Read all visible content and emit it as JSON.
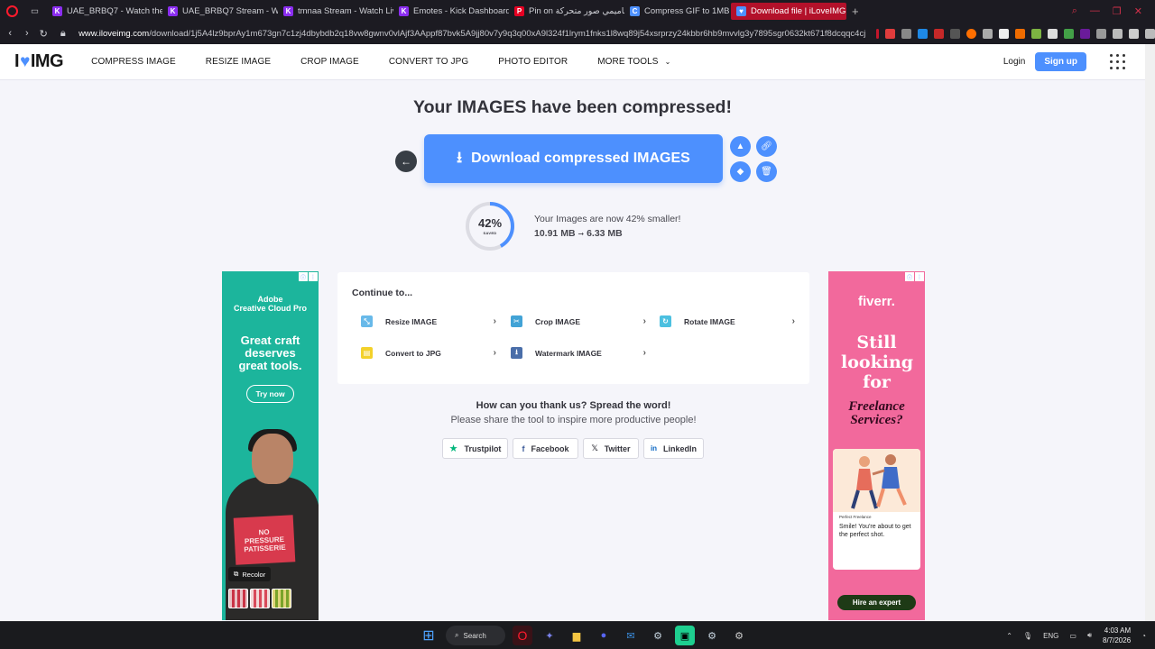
{
  "browser": {
    "tabs": [
      {
        "title": "UAE_BRBQ7 - Watch the VO",
        "icon_color": "#8b2df0",
        "icon_letter": "K"
      },
      {
        "title": "UAE_BRBQ7 Stream - Watc",
        "icon_color": "#8b2df0",
        "icon_letter": "K"
      },
      {
        "title": "tmnaa Stream - Watch Live",
        "icon_color": "#8b2df0",
        "icon_letter": "K"
      },
      {
        "title": "Emotes - Kick Dashboard",
        "icon_color": "#8b2df0",
        "icon_letter": "K"
      },
      {
        "title": "Pin on تصاميمي صور متحركة",
        "icon_color": "#e60023",
        "icon_letter": "P"
      },
      {
        "title": "Compress GIF to 1MB",
        "icon_color": "#4d90fe",
        "icon_letter": "C"
      },
      {
        "title": "Download file | iLoveIMG",
        "icon_color": "#4d90fe",
        "icon_letter": "♥",
        "active": true
      }
    ],
    "url_host": "www.iloveimg.com",
    "url_path": "/download/1j5A4lz9bprAy1m673gn7c1zj4dbybdb2q18vw8gwnv0vlAjf3AAppf87bvk5A9jj80v7y9q3q00xA9l324f1lrym1fnks1l8wq89j54xsrprzy24kbbr6hb9mvvlg3y7895sgr0632kt671f8dcqqc4cjk540pvlya"
  },
  "header": {
    "logo_left": "I",
    "logo_right": "IMG",
    "menu": [
      "COMPRESS IMAGE",
      "RESIZE IMAGE",
      "CROP IMAGE",
      "CONVERT TO JPG",
      "PHOTO EDITOR",
      "MORE TOOLS"
    ],
    "login": "Login",
    "signup": "Sign up"
  },
  "main": {
    "title": "Your IMAGES have been compressed!",
    "download_label": "Download compressed IMAGES",
    "saved_percent": 42,
    "saved_percent_text": "42%",
    "saved_label": "SAVED",
    "smaller_message": "Your Images are now 42% smaller!",
    "size_before": "10.91 MB",
    "size_after": "6.33 MB",
    "size_arrow": "➞"
  },
  "continue": {
    "title": "Continue to...",
    "tools": [
      {
        "label": "Resize IMAGE",
        "color": "#68b9e9"
      },
      {
        "label": "Crop IMAGE",
        "color": "#42a3d6"
      },
      {
        "label": "Rotate IMAGE",
        "color": "#4cc0e0"
      },
      {
        "label": "Convert to JPG",
        "color": "#f3d12b"
      },
      {
        "label": "Watermark IMAGE",
        "color": "#4a6ea9"
      }
    ]
  },
  "share": {
    "title": "How can you thank us? Spread the word!",
    "subtitle": "Please share the tool to inspire more productive people!",
    "buttons": [
      "Trustpilot",
      "Facebook",
      "Twitter",
      "LinkedIn"
    ]
  },
  "ads": {
    "left": {
      "brand_line1": "Adobe",
      "brand_line2": "Creative Cloud Pro",
      "headline": "Great craft deserves great tools.",
      "cta": "Try now",
      "box_text": "NO PRESSURE PATISSERIE",
      "recolor": "Recolor"
    },
    "right": {
      "brand": "fiverr.",
      "headline": "Still looking for",
      "subhead": "Freelance Services?",
      "card_caption": "Perfect Freelance",
      "card_message": "Smile! You're about to get the perfect shot.",
      "cta": "Hire an expert"
    }
  },
  "taskbar": {
    "search": "Search",
    "lang": "ENG",
    "time": "4:03 AM",
    "date": "8/7/2026"
  }
}
